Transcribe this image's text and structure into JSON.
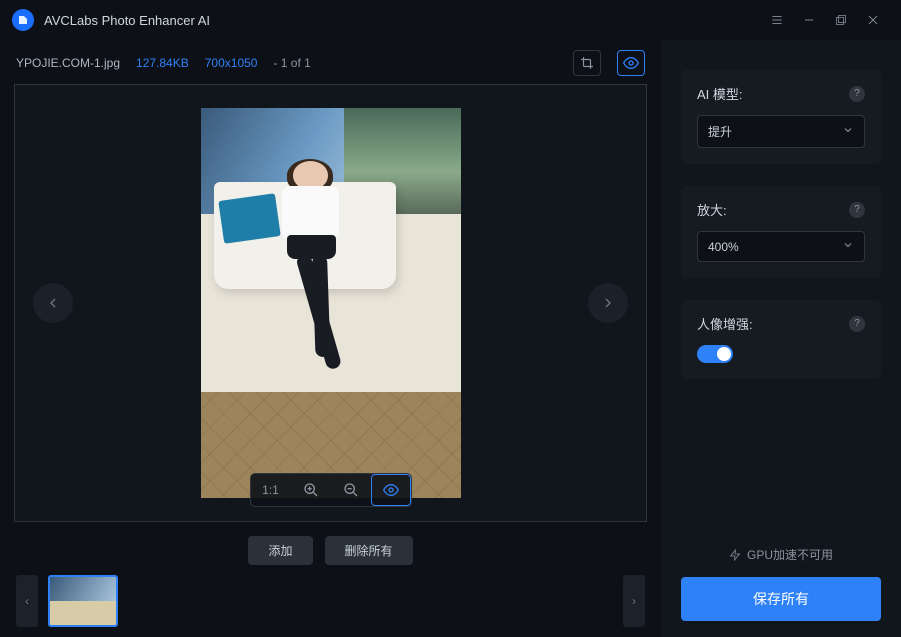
{
  "titlebar": {
    "app_name": "AVCLabs Photo Enhancer AI"
  },
  "file_info": {
    "filename": "YPOJIE.COM-1.jpg",
    "filesize": "127.84KB",
    "dimensions": "700x1050",
    "index": "- 1 of 1"
  },
  "zoom": {
    "fit_label": "1:1"
  },
  "actions": {
    "add": "添加",
    "delete_all": "删除所有"
  },
  "panels": {
    "model": {
      "label": "AI 模型:",
      "value": "提升"
    },
    "scale": {
      "label": "放大:",
      "value": "400%"
    },
    "face": {
      "label": "人像增强:"
    }
  },
  "footer": {
    "gpu_text": "GPU加速不可用",
    "save_all": "保存所有"
  }
}
